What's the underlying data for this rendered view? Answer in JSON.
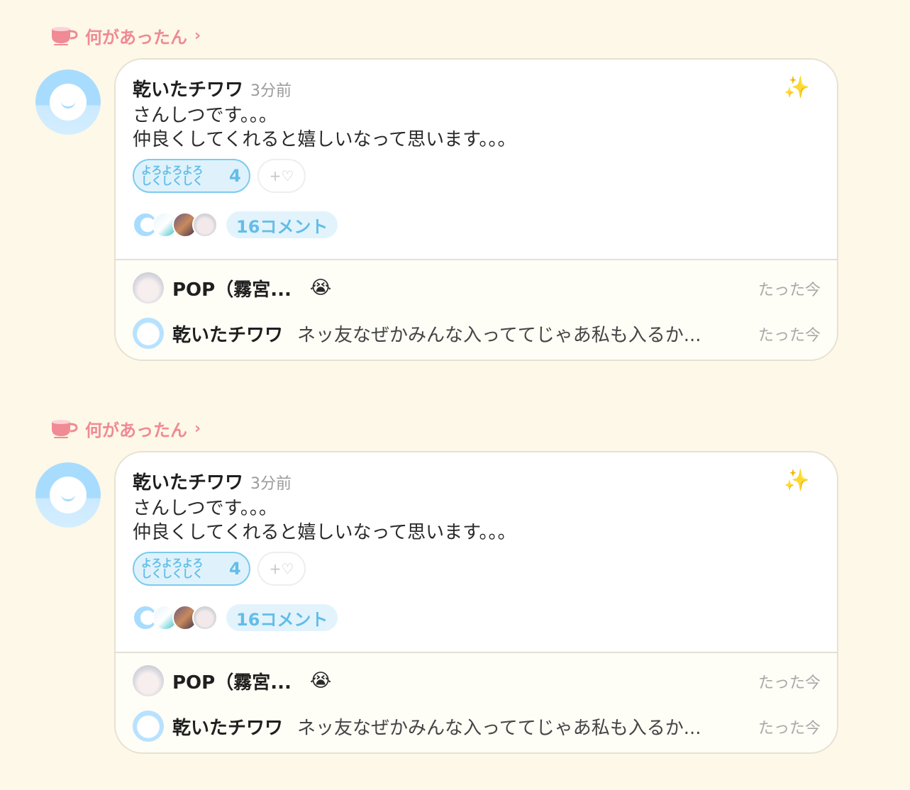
{
  "posts": [
    {
      "category": {
        "label": "何があったん",
        "icon": "tea-cup-icon",
        "chevron": "›"
      },
      "author": "乾いたチワワ",
      "time": "3分前",
      "sparkle": "✨",
      "body_lines": [
        "さんしつです。。。",
        "仲良くしてくれると嬉しいなって思います。。。"
      ],
      "stamp": {
        "line1": "よろよろよろ",
        "line2": "しくしくしく",
        "count": "4"
      },
      "add_reaction": "+♡",
      "comments_label": "16コメント",
      "replies": [
        {
          "name": "POP（霧宮...",
          "emoji": "😭",
          "text": "",
          "time": "たった今"
        },
        {
          "name": "乾いたチワワ",
          "emoji": "",
          "text": "ネッ友なぜかみんな入っててじゃあ私も入るか...",
          "time": "たった今"
        }
      ]
    },
    {
      "category": {
        "label": "何があったん",
        "icon": "tea-cup-icon",
        "chevron": "›"
      },
      "author": "乾いたチワワ",
      "time": "3分前",
      "sparkle": "✨",
      "body_lines": [
        "さんしつです。。。",
        "仲良くしてくれると嬉しいなって思います。。。"
      ],
      "stamp": {
        "line1": "よろよろよろ",
        "line2": "しくしくしく",
        "count": "4"
      },
      "add_reaction": "+♡",
      "comments_label": "16コメント",
      "replies": [
        {
          "name": "POP（霧宮...",
          "emoji": "😭",
          "text": "",
          "time": "たった今"
        },
        {
          "name": "乾いたチワワ",
          "emoji": "",
          "text": "ネッ友なぜかみんな入っててじゃあ私も入るか...",
          "time": "たった今"
        }
      ]
    }
  ],
  "colors": {
    "background": "#fdf8e8",
    "category_pink": "#f08a94",
    "accent_blue": "#62bde8"
  }
}
